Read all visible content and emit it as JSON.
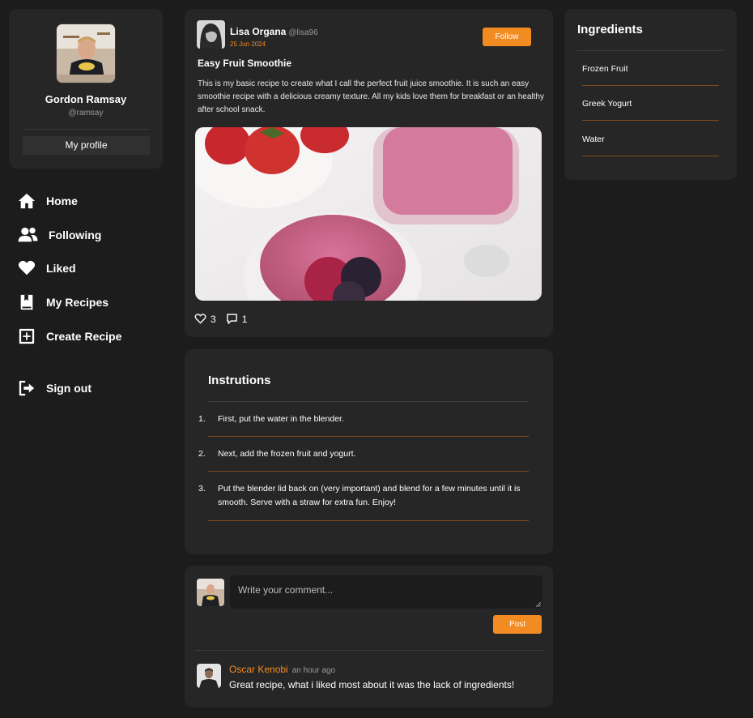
{
  "profile": {
    "name": "Gordon Ramsay",
    "handle": "@ramsay",
    "button_label": "My profile"
  },
  "nav": {
    "items": [
      {
        "label": "Home",
        "icon": "home-icon"
      },
      {
        "label": "Following",
        "icon": "users-icon"
      },
      {
        "label": "Liked",
        "icon": "heart-icon"
      },
      {
        "label": "My Recipes",
        "icon": "book-icon"
      },
      {
        "label": "Create Recipe",
        "icon": "plus-square-icon"
      },
      {
        "label": "Sign out",
        "icon": "sign-out-icon"
      }
    ]
  },
  "post": {
    "author_name": "Lisa Organa",
    "author_handle": "@lisa96",
    "date": "25 Jun 2024",
    "follow_label": "Follow",
    "title": "Easy Fruit Smoothie",
    "body": "This is my basic recipe to create what I call the perfect fruit juice smoothie. It is such an easy smoothie recipe with a delicious creamy texture. All my kids love them for breakfast or an healthy after school snack.",
    "likes": "3",
    "comments": "1"
  },
  "instructions": {
    "title": "Instrutions",
    "steps": [
      {
        "num": "1.",
        "text": "First, put the water in the blender."
      },
      {
        "num": "2.",
        "text": "Next, add the frozen fruit and yogurt."
      },
      {
        "num": "3.",
        "text": "Put the blender lid back on (very important) and blend for a few minutes until it is smooth. Serve with a straw for extra fun. Enjoy!"
      }
    ]
  },
  "comment_box": {
    "placeholder": "Write your comment...",
    "post_label": "Post"
  },
  "comments": [
    {
      "name": "Oscar Kenobi",
      "time": "an hour ago",
      "text": "Great recipe, what i liked most about it was the lack of ingredients!"
    }
  ],
  "ingredients": {
    "title": "Ingredients",
    "items": [
      "Frozen Fruit",
      "Greek Yogurt",
      "Water"
    ]
  },
  "colors": {
    "accent": "#f28c22",
    "background": "#1c1c1c",
    "card": "#262626"
  }
}
